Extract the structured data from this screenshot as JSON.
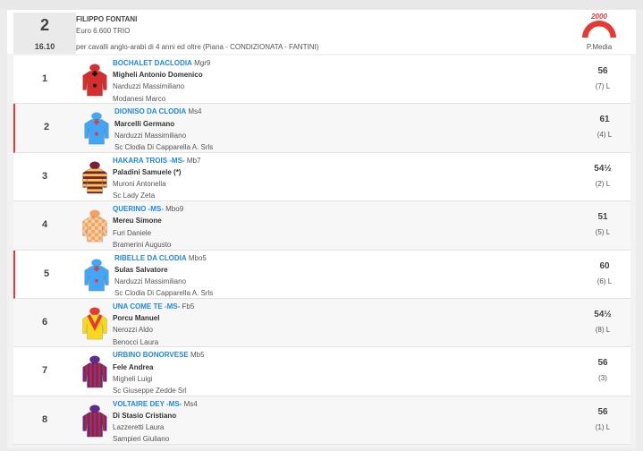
{
  "race": {
    "number": "2",
    "time": "16.10",
    "title": "FILIPPO FONTANI",
    "purse": "Euro 6.600 TRIO",
    "conditions": "per cavalli anglo-arabi di 4 anni ed oltre (Piana -  CONDIZIONATA  - FANTINI)",
    "logo_text": "2000",
    "logo_label": "P.Media"
  },
  "colors": {
    "horse_link": "#1e88e5",
    "flag_border": "#e53935",
    "logo_red": "#e53935"
  },
  "runners": [
    {
      "number": "1",
      "horse": "BOCHALET DACLODIA",
      "category": "Mgr9",
      "jockey": "Migheli Antonio Domenico",
      "trainer": "Narduzzi Massimiliano",
      "owner": "Modanesi Marco",
      "odds": "56",
      "rank": "(7) L",
      "silk_icon": "jockey-silk-red-icon",
      "flag": false
    },
    {
      "number": "2",
      "horse": "DIONISO DA CLODIA",
      "category": "Ms4",
      "jockey": "Marcelli Germano",
      "trainer": "Narduzzi Massimiliano",
      "owner": "Sc Clodia Di Capparella A. Srls",
      "odds": "61",
      "rank": "(4) L",
      "silk_icon": "jockey-silk-blue-icon",
      "flag": true
    },
    {
      "number": "3",
      "horse": "HAKARA TROIS -MS-",
      "category": "Mb7",
      "jockey": "Paladini Samuele (*)",
      "trainer": "Muroni Antonella",
      "owner": "Sc Lady Zeta",
      "odds": "54½",
      "rank": "(2) L",
      "silk_icon": "jockey-silk-hooped-icon",
      "flag": false
    },
    {
      "number": "4",
      "horse": "QUERINO -MS-",
      "category": "Mbo9",
      "jockey": "Mereu Simone",
      "trainer": "Furi Daniele",
      "owner": "Bramerini Augusto",
      "odds": "51",
      "rank": "(5) L",
      "silk_icon": "jockey-silk-orange-icon",
      "flag": false
    },
    {
      "number": "5",
      "horse": "RIBELLE DA CLODIA",
      "category": "Mbo5",
      "jockey": "Sulas Salvatore",
      "trainer": "Narduzzi Massimiliano",
      "owner": "Sc Clodia Di Capparella A. Srls",
      "odds": "60",
      "rank": "(6) L",
      "silk_icon": "jockey-silk-blue-icon",
      "flag": true
    },
    {
      "number": "6",
      "horse": "UNA COME TE -MS-",
      "category": "Fb5",
      "jockey": "Porcu Manuel",
      "trainer": "Nerozzi Aldo",
      "owner": "Benocci Laura",
      "odds": "54½",
      "rank": "(8) L",
      "silk_icon": "jockey-silk-yellow-icon",
      "flag": false
    },
    {
      "number": "7",
      "horse": "URBINO BONORVESE",
      "category": "Mb5",
      "jockey": "Fele Andrea",
      "trainer": "Migheli Luigi",
      "owner": "Sc Giuseppe Zedde Srl",
      "odds": "56",
      "rank": "(3)",
      "silk_icon": "jockey-silk-striped-icon",
      "flag": false
    },
    {
      "number": "8",
      "horse": "VOLTAIRE DEY -MS-",
      "category": "Ms4",
      "jockey": "Di Stasio Cristiano",
      "trainer": "Lazzeretti Laura",
      "owner": "Sampieri Giuliano",
      "odds": "56",
      "rank": "(1) L",
      "silk_icon": "jockey-silk-striped-icon",
      "flag": false
    }
  ]
}
